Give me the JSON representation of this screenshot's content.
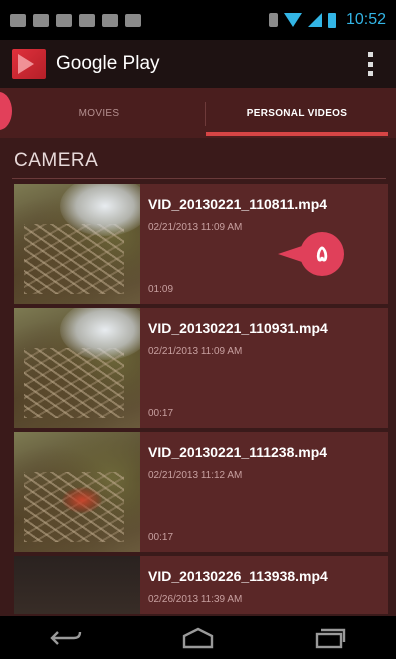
{
  "status_bar": {
    "time": "10:52"
  },
  "action_bar": {
    "title": "Google Play"
  },
  "tabs": [
    {
      "label": "MOVIES",
      "active": false
    },
    {
      "label": "PERSONAL VIDEOS",
      "active": true
    }
  ],
  "section": {
    "header": "CAMERA"
  },
  "videos": [
    {
      "title": "VID_20130221_110811.mp4",
      "date": "02/21/2013 11:09 AM",
      "duration": "01:09"
    },
    {
      "title": "VID_20130221_110931.mp4",
      "date": "02/21/2013 11:09 AM",
      "duration": "00:17"
    },
    {
      "title": "VID_20130221_111238.mp4",
      "date": "02/21/2013 11:12 AM",
      "duration": "00:17"
    },
    {
      "title": "VID_20130226_113938.mp4",
      "date": "02/26/2013 11:39 AM",
      "duration": ""
    }
  ],
  "callout": {
    "label": "۵"
  },
  "colors": {
    "accent": "#d64545",
    "callout": "#e0405a",
    "status_blue": "#33b5e5",
    "background": "#3a1a1a"
  },
  "icons": {
    "nav": [
      "back-icon",
      "home-icon",
      "recent-apps-icon"
    ],
    "status_left": [
      "email-icon",
      "chat-icon",
      "file-icon",
      "briefcase-icon",
      "briefcase-icon",
      "gamepad-icon"
    ],
    "status_right": [
      "bluetooth-icon",
      "wifi-icon",
      "signal-icon",
      "battery-icon"
    ]
  }
}
